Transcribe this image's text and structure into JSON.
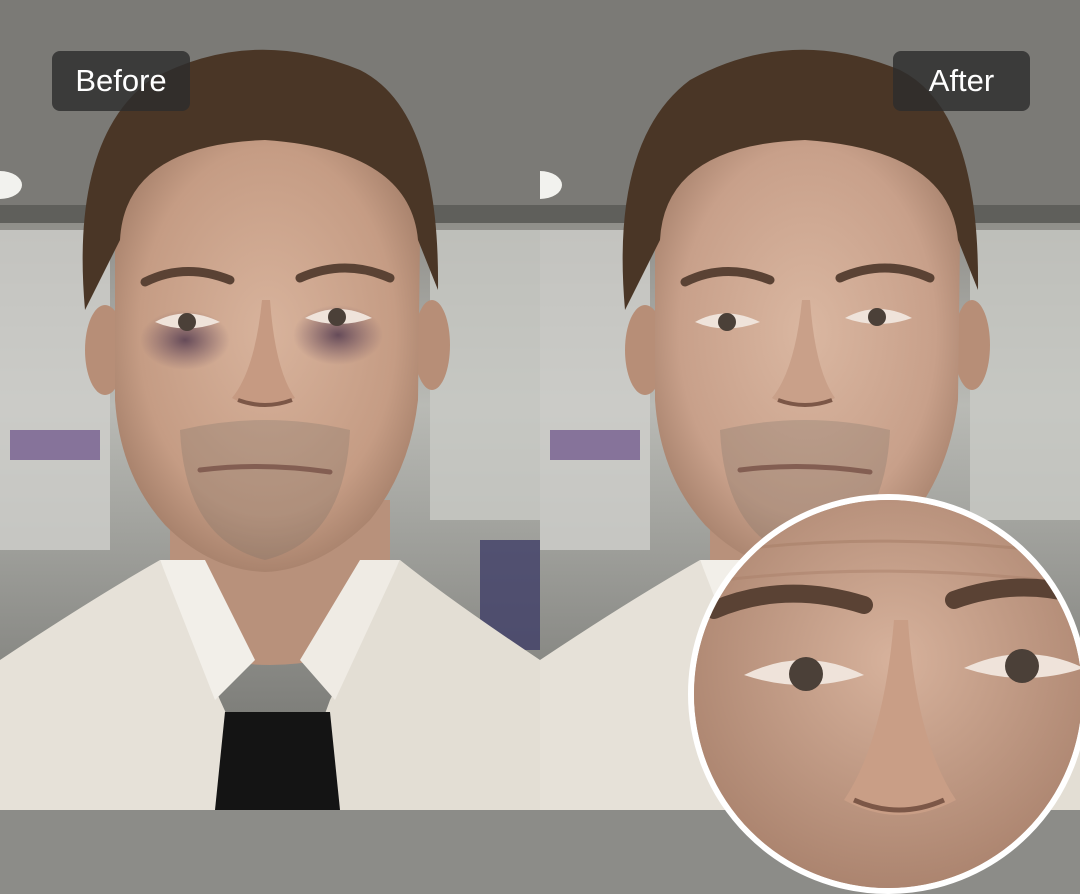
{
  "labels": {
    "before": "Before",
    "after": "After"
  },
  "panels": {
    "before": {
      "name": "before-photo",
      "dark_circles": true
    },
    "after": {
      "name": "after-photo",
      "dark_circles": false
    }
  },
  "zoom_inset": {
    "shows": "after-eye-region-closeup"
  },
  "colors": {
    "badge_bg": "#2d2d2d",
    "badge_text": "#ffffff",
    "lens_border": "#ffffff",
    "shirt": "#e6e1d8",
    "tie": "#141414",
    "skin": "#c9a48e",
    "hair": "#4a3626"
  }
}
